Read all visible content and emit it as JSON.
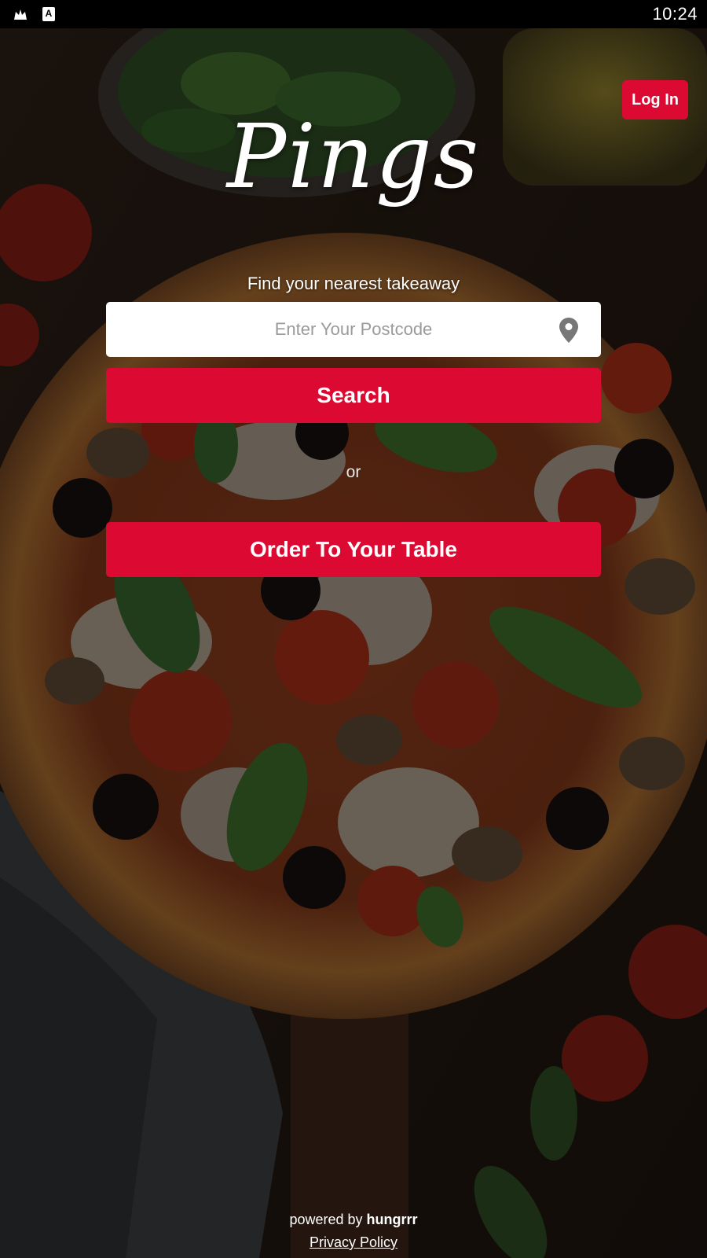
{
  "status_bar": {
    "time": "10:24",
    "icons": [
      "notification-icon",
      "a-badge-icon"
    ],
    "a_badge": "A"
  },
  "header": {
    "login_label": "Log In"
  },
  "brand": {
    "logo_text": "Pings"
  },
  "search": {
    "tagline": "Find your nearest takeaway",
    "postcode_placeholder": "Enter Your Postcode",
    "postcode_value": "",
    "location_icon": "map-pin-icon",
    "search_label": "Search"
  },
  "divider": {
    "or_text": "or"
  },
  "order": {
    "table_label": "Order To Your Table"
  },
  "footer": {
    "powered_by": "powered by",
    "brand": "hungrrr",
    "privacy_label": "Privacy Policy"
  },
  "colors": {
    "accent": "#dc0a32",
    "text_light": "#ffffff",
    "input_bg": "#ffffff",
    "status_bar_bg": "#000000"
  }
}
